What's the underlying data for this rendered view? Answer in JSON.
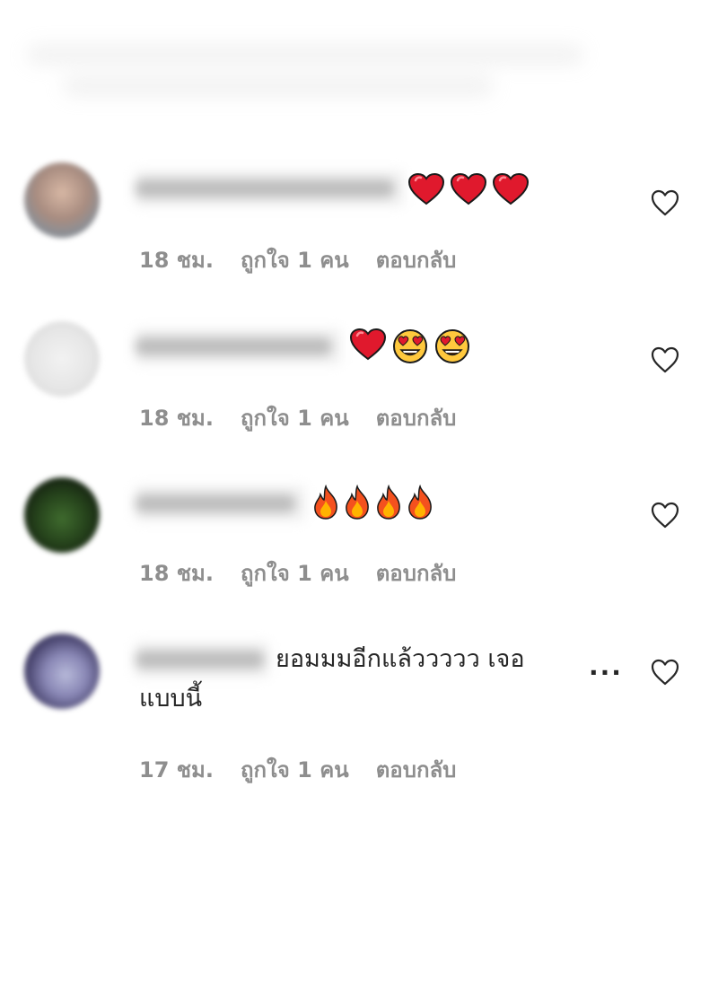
{
  "comments": [
    {
      "emojis": [
        "heart",
        "heart",
        "heart"
      ],
      "time": "18 ชม.",
      "likes": "ถูกใจ 1 คน",
      "reply": "ตอบกลับ"
    },
    {
      "emojis": [
        "heart",
        "heart-eyes",
        "heart-eyes"
      ],
      "time": "18 ชม.",
      "likes": "ถูกใจ 1 คน",
      "reply": "ตอบกลับ"
    },
    {
      "emojis": [
        "fire",
        "fire",
        "fire",
        "fire"
      ],
      "time": "18 ชม.",
      "likes": "ถูกใจ 1 คน",
      "reply": "ตอบกลับ"
    },
    {
      "text_line1": "ยอมมมอีกแล้ววววว เจอ",
      "text_line2": "แบบนี้",
      "more": "...",
      "time": "17 ชม.",
      "likes": "ถูกใจ 1 คน",
      "reply": "ตอบกลับ"
    }
  ],
  "colors": {
    "text": "#262626",
    "meta": "#8e8e8e",
    "heart_emoji": "#e0192d",
    "like_icon": "#262626"
  },
  "icons": {
    "like": "heart-outline-icon",
    "more": "ellipsis-icon"
  }
}
